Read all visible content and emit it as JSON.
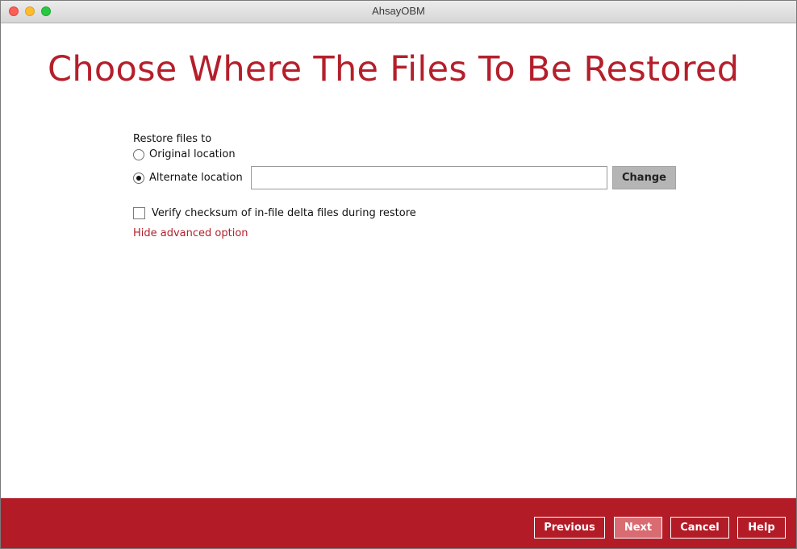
{
  "window": {
    "title": "AhsayOBM"
  },
  "page": {
    "title": "Choose Where The Files To Be Restored"
  },
  "restore": {
    "label": "Restore files to",
    "options": [
      {
        "label": "Original location",
        "selected": false
      },
      {
        "label": "Alternate location",
        "selected": true
      }
    ],
    "path_value": "",
    "change_label": "Change"
  },
  "advanced": {
    "verify_checksum_label": "Verify checksum of in-file delta files during restore",
    "verify_checksum_checked": false,
    "toggle_label": "Hide advanced option"
  },
  "footer": {
    "previous_label": "Previous",
    "next_label": "Next",
    "next_enabled": false,
    "cancel_label": "Cancel",
    "help_label": "Help"
  },
  "colors": {
    "brand_red": "#b31c27",
    "title_red": "#b41f2b",
    "disabled_button": "#d96b72"
  }
}
